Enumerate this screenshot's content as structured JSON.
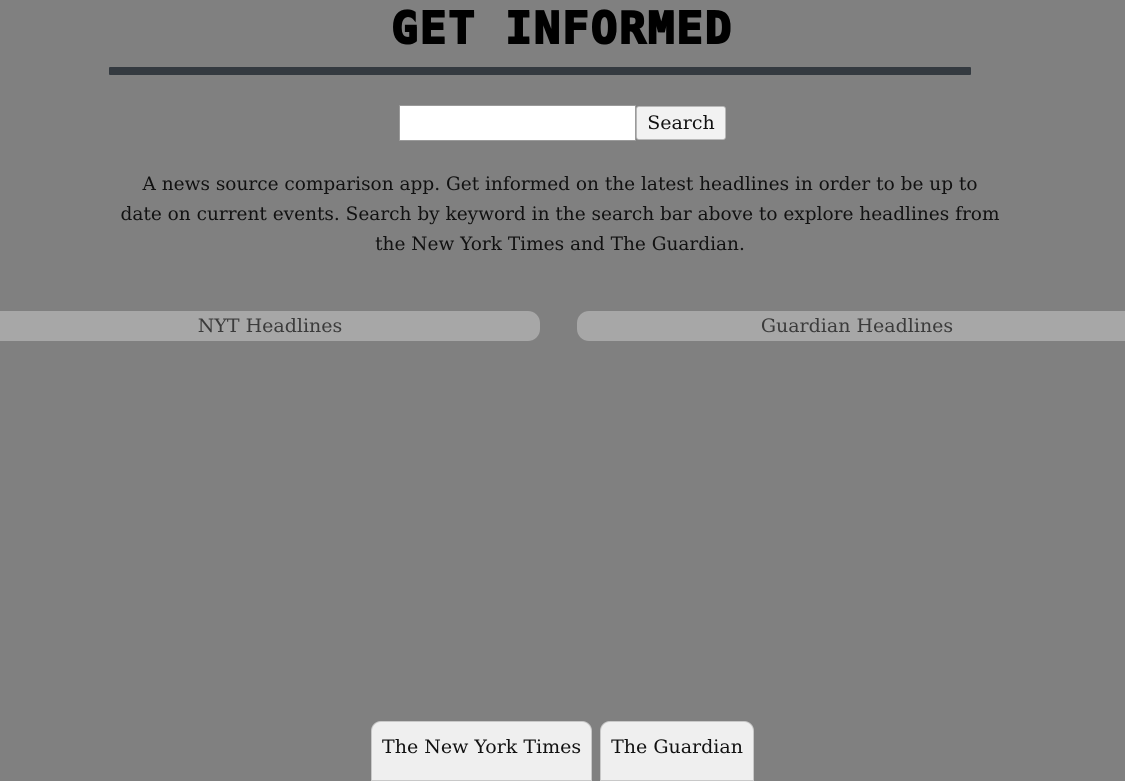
{
  "header": {
    "title": "GET INFORMED"
  },
  "search": {
    "placeholder": "",
    "value": "",
    "button_label": "Search"
  },
  "description": "A news source comparison app. Get informed on the latest headlines in order to be up to date on current events. Search by keyword in the search bar above to explore headlines from the New York Times and The Guardian.",
  "headlines": {
    "nyt_label": "NYT Headlines",
    "guardian_label": "Guardian Headlines"
  },
  "sources": [
    {
      "label": "The New York Times"
    },
    {
      "label": "The Guardian"
    }
  ],
  "colors": {
    "background": "#808080",
    "divider": "#343a40",
    "headline_bar": "#a7a7a7"
  }
}
